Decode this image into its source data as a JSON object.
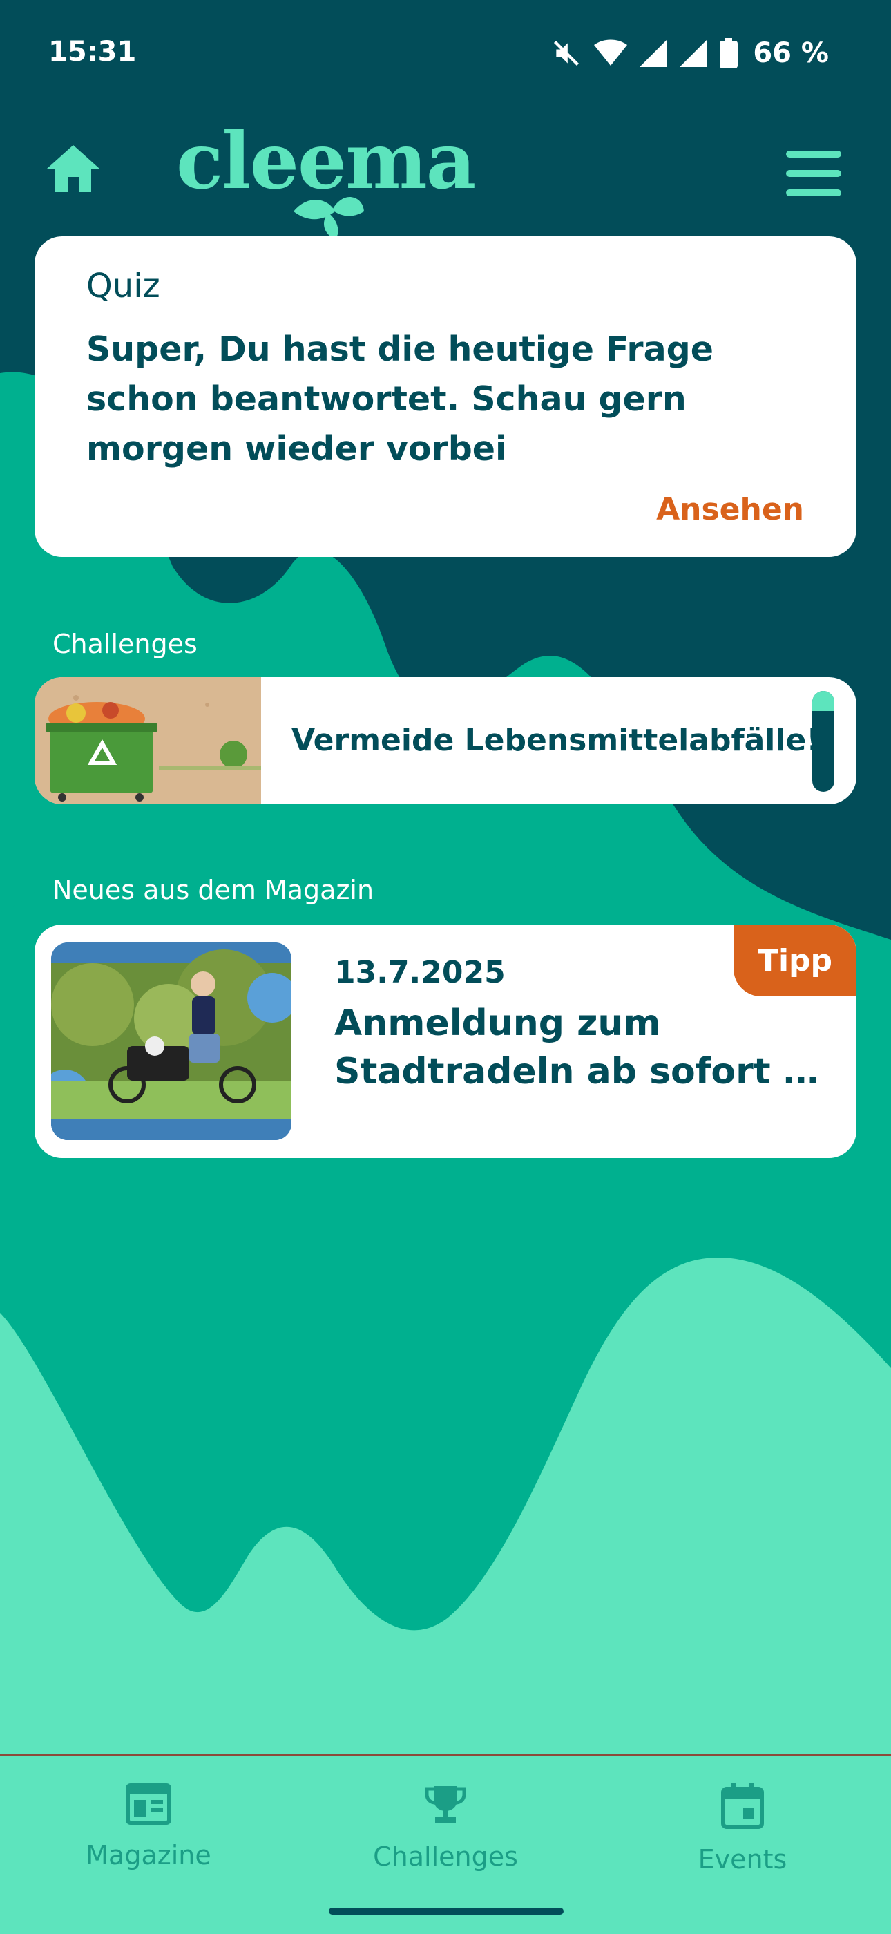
{
  "status_bar": {
    "time": "15:31",
    "battery": "66 %",
    "icons": [
      "mute-icon",
      "wifi-icon",
      "signal-icon",
      "signal-icon",
      "battery-icon"
    ]
  },
  "header": {
    "logo": "cleema",
    "icons": [
      "home-icon",
      "menu-icon"
    ]
  },
  "quiz": {
    "title": "Quiz",
    "text": "Super, Du hast die heutige Frage schon beantwortet. Schau gern morgen wieder vorbei",
    "action": "Ansehen"
  },
  "challenges": {
    "section_label": "Challenges",
    "item": {
      "title": "Vermeide Lebensmittelabfälle!",
      "progress": 0.2
    }
  },
  "magazine": {
    "section_label": "Neues aus dem Magazin",
    "item": {
      "date": "13.7.2025",
      "title_line1": "Anmeldung zum",
      "title_line2": "Stadtradeln ab sofort mö...",
      "badge": "Tipp"
    }
  },
  "bottom_nav": {
    "items": [
      {
        "label": "Magazine",
        "icon": "newspaper-icon"
      },
      {
        "label": "Challenges",
        "icon": "trophy-icon"
      },
      {
        "label": "Events",
        "icon": "calendar-icon"
      }
    ]
  },
  "colors": {
    "dark_teal": "#024d59",
    "mid_teal": "#00b08f",
    "mint": "#5de4bd",
    "accent_orange": "#d9621b"
  }
}
